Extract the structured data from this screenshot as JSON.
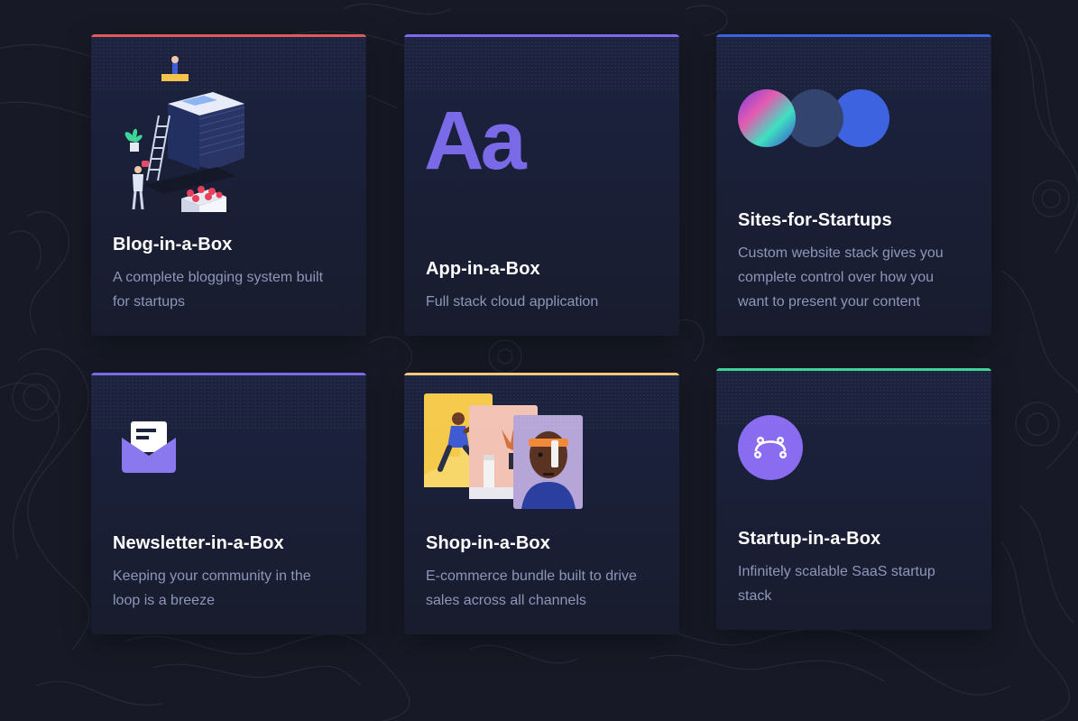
{
  "cards": [
    {
      "title": "Blog-in-a-Box",
      "description": "A complete blogging system built for startups",
      "icon": "blog-illustration",
      "accent": "#e05a5a"
    },
    {
      "title": "App-in-a-Box",
      "description": "Full stack cloud application",
      "icon": "typography-aa",
      "glyph": "Aa",
      "accent": "#7b6ae8"
    },
    {
      "title": "Sites-for-Startups",
      "description": "Custom website stack gives you complete control over how you want to present your content",
      "icon": "three-circles",
      "accent": "#3d63e0"
    },
    {
      "title": "Newsletter-in-a-Box",
      "description": "Keeping your community in the loop is a breeze",
      "icon": "envelope-icon",
      "accent": "#7b6ae8"
    },
    {
      "title": "Shop-in-a-Box",
      "description": "E-commerce bundle built to drive sales across all channels",
      "icon": "product-photos",
      "accent": "#f0c87a"
    },
    {
      "title": "Startup-in-a-Box",
      "description": "Infinitely scalable SaaS startup stack",
      "icon": "nodes-icon",
      "accent": "#3fd39a"
    }
  ]
}
